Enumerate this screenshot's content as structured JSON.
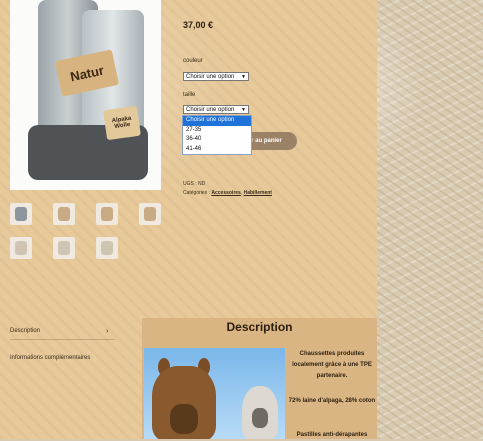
{
  "product": {
    "price": "37,00 €",
    "image_labels": {
      "brand": "Natur",
      "tag": "Alpaka Wolle"
    }
  },
  "variations": {
    "couleur_label": "couleur",
    "couleur_value": "Choisir une option",
    "taille_label": "taille",
    "taille_value": "Choisir une option",
    "taille_options": [
      "Choisir une option",
      "27-35",
      "36-40",
      "41-46"
    ]
  },
  "cart": {
    "add_label": "r au panier"
  },
  "meta": {
    "ugs": "UGS : ND",
    "categories_label": "Catégories :",
    "category_1": "Accessoires",
    "separator": ",",
    "category_2": "Habillement"
  },
  "tabs": {
    "description": "Description",
    "info": "Informations complémentaires"
  },
  "description": {
    "heading": "Description",
    "line1": "Chaussettes produites localement grâce à une TPE partenaire.",
    "line2": "72% laine d'alpaga, 28% coton",
    "line3": "Pastilles anti-dérapantes"
  },
  "icons": {
    "select_arrow": "chevron-down-icon",
    "tab_arrow": "chevron-right-icon"
  }
}
